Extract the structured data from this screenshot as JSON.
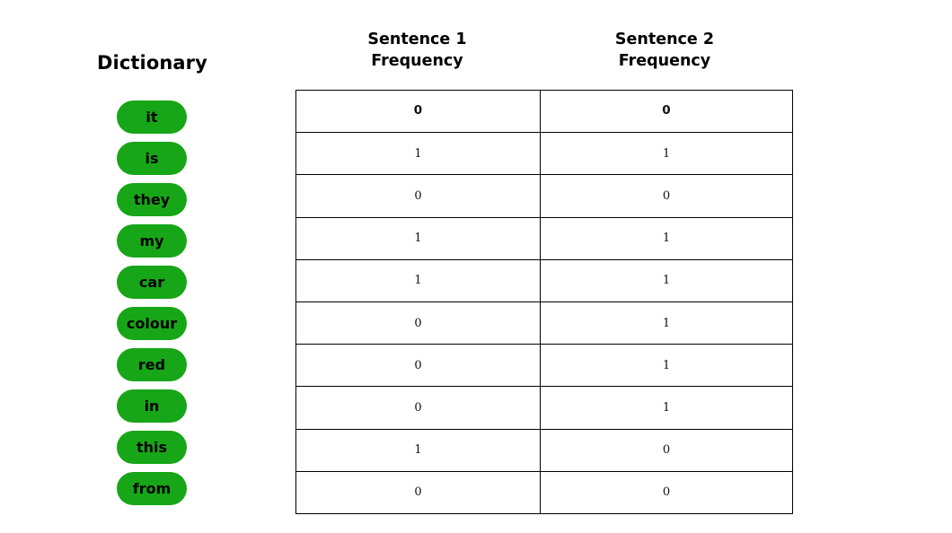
{
  "colors": {
    "pill_green": "#17a617",
    "text": "#000000",
    "border": "#000000",
    "background": "#ffffff"
  },
  "dictionary": {
    "title": "Dictionary",
    "words": [
      "it",
      "is",
      "they",
      "my",
      "car",
      "colour",
      "red",
      "in",
      "this",
      "from"
    ]
  },
  "table": {
    "headers": [
      {
        "line1": "Sentence 1",
        "line2": "Frequency",
        "full": "Sentence 1\nFrequency"
      },
      {
        "line1": "Sentence 2",
        "line2": "Frequency",
        "full": "Sentence 2\nFrequency"
      }
    ],
    "rows": [
      {
        "word": "it",
        "sentence1": "0",
        "sentence2": "0"
      },
      {
        "word": "is",
        "sentence1": "1",
        "sentence2": "1"
      },
      {
        "word": "they",
        "sentence1": "0",
        "sentence2": "0"
      },
      {
        "word": "my",
        "sentence1": "1",
        "sentence2": "1"
      },
      {
        "word": "car",
        "sentence1": "1",
        "sentence2": "1"
      },
      {
        "word": "colour",
        "sentence1": "0",
        "sentence2": "1"
      },
      {
        "word": "red",
        "sentence1": "0",
        "sentence2": "1"
      },
      {
        "word": "in",
        "sentence1": "0",
        "sentence2": "1"
      },
      {
        "word": "this",
        "sentence1": "1",
        "sentence2": "0"
      },
      {
        "word": "from",
        "sentence1": "0",
        "sentence2": "0"
      }
    ]
  },
  "chart_data": {
    "type": "table",
    "title": "",
    "categories": [
      "it",
      "is",
      "they",
      "my",
      "car",
      "colour",
      "red",
      "in",
      "this",
      "from"
    ],
    "series": [
      {
        "name": "Sentence 1 Frequency",
        "values": [
          0,
          1,
          0,
          1,
          1,
          0,
          0,
          0,
          1,
          0
        ]
      },
      {
        "name": "Sentence 2 Frequency",
        "values": [
          0,
          1,
          0,
          1,
          1,
          1,
          1,
          1,
          0,
          0
        ]
      }
    ],
    "xlabel": "Dictionary",
    "ylabel": "Frequency",
    "legend": [
      "Sentence 1 Frequency",
      "Sentence 2 Frequency"
    ],
    "grid": true
  }
}
